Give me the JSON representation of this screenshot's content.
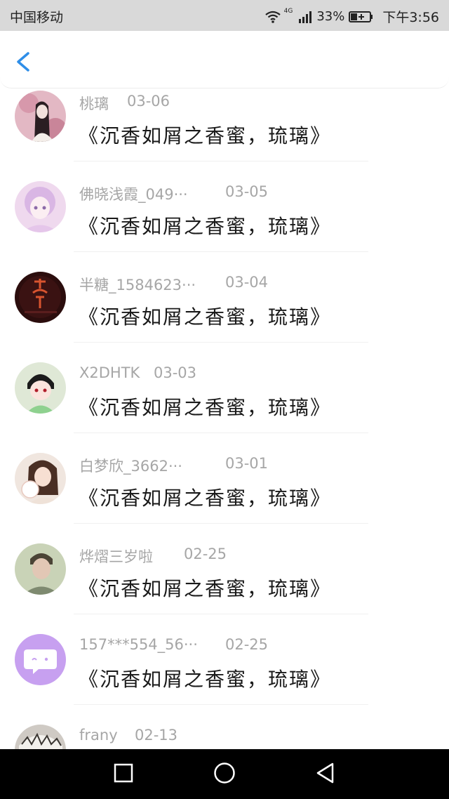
{
  "status_bar": {
    "carrier": "中国移动",
    "network": "4G",
    "battery": "33%",
    "time": "下午3:56"
  },
  "header": {
    "back_icon": "chevron-left-icon"
  },
  "comments": [
    {
      "user": "桃璃",
      "date": "03-06",
      "text": "《沉香如屑之香蜜，琉璃》"
    },
    {
      "user": "佛晓浅霞_049···",
      "date": "03-05",
      "text": "《沉香如屑之香蜜，琉璃》"
    },
    {
      "user": "半糖_1584623···",
      "date": "03-04",
      "text": "《沉香如屑之香蜜，琉璃》"
    },
    {
      "user": "X2DHTK",
      "date": "03-03",
      "text": "《沉香如屑之香蜜，琉璃》"
    },
    {
      "user": "白梦欣_3662···",
      "date": "03-01",
      "text": "《沉香如屑之香蜜，琉璃》"
    },
    {
      "user": "烨熠三岁啦",
      "date": "02-25",
      "text": "《沉香如屑之香蜜，琉璃》"
    },
    {
      "user": "157***554_56···",
      "date": "02-25",
      "text": "《沉香如屑之香蜜，琉璃》"
    },
    {
      "user": "frany",
      "date": "02-13",
      "text": ""
    }
  ],
  "colors": {
    "accent": "#2f8ee8",
    "meta_text": "#a6a6a6",
    "status_bar_bg": "#d9d9d9"
  },
  "nav_icons": [
    "square-icon",
    "circle-icon",
    "triangle-back-icon"
  ]
}
